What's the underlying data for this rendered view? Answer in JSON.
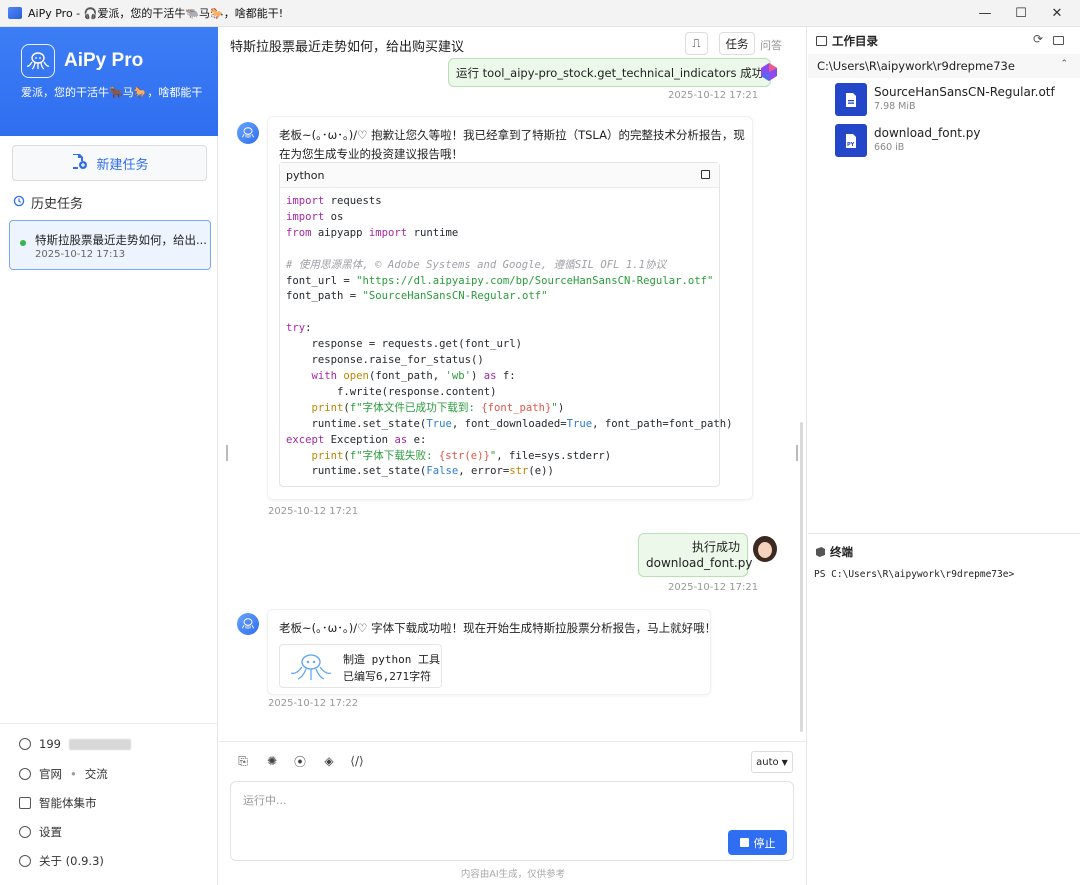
{
  "window": {
    "title": "AiPy Pro - 🎧爱派，您的干活牛🐃马🐎，啥都能干!",
    "controls": {
      "minimize": "—",
      "maximize": "☐",
      "close": "✕"
    }
  },
  "sidebar": {
    "brand_name": "AiPy Pro",
    "slogan": "爱派，您的干活牛🐂马🐎，啥都能干",
    "new_task_label": "新建任务",
    "history_title": "历史任务",
    "history_items": [
      {
        "label": "特斯拉股票最近走势如何，给出...",
        "time": "2025-10-12 17:13"
      }
    ],
    "bottom": {
      "account": "199",
      "official_site": "官网",
      "separator": "•",
      "community": "交流",
      "agent_market": "智能体集市",
      "settings": "设置",
      "about": "关于 (0.9.3)"
    }
  },
  "chat": {
    "title": "特斯拉股票最近走势如何，给出购买建议",
    "tabs": {
      "task": "任务",
      "qa": "问答"
    },
    "messages": {
      "m1": {
        "text": "运行 tool_aipy-pro_stock.get_technical_indicators 成功",
        "time": "2025-10-12 17:21"
      },
      "m2": {
        "text_line1": "老板~(｡･ω･｡)/♡ 抱歉让您久等啦！我已经拿到了特斯拉（TSLA）的完整技术分析报告，现",
        "text_line2": "在为您生成专业的投资建议报告哦！",
        "code_lang": "python",
        "time": "2025-10-12 17:21"
      },
      "m3": {
        "line1": "执行成功",
        "line2": "download_font.py",
        "time": "2025-10-12 17:21"
      },
      "m4": {
        "text": "老板~(｡･ω･｡)/♡ 字体下载成功啦！现在开始生成特斯拉股票分析报告，马上就好哦！",
        "tool_title": "制造 python 工具",
        "tool_sub": "已编写6,271字符",
        "time": "2025-10-12 17:22"
      }
    },
    "composer": {
      "model": "auto",
      "placeholder": "运行中...",
      "stop_label": "停止",
      "disclaimer": "内容由AI生成，仅供参考"
    }
  },
  "right_panel": {
    "workdir_title": "工作目录",
    "path": "C:\\Users\\R\\aipywork\\r9drepme73e",
    "files": [
      {
        "name": "SourceHanSansCN-Regular.otf",
        "size": "7.98 MiB",
        "icon": "otf-file-icon"
      },
      {
        "name": "download_font.py",
        "size": "660 iB",
        "icon": "python-file-icon"
      }
    ],
    "terminal_title": "终端",
    "terminal_prompt": "PS C:\\Users\\R\\aipywork\\r9drepme73e>"
  },
  "colors": {
    "accent": "#2f6ef0",
    "user_bubble": "#ecf8ea",
    "online": "#36b34a"
  }
}
